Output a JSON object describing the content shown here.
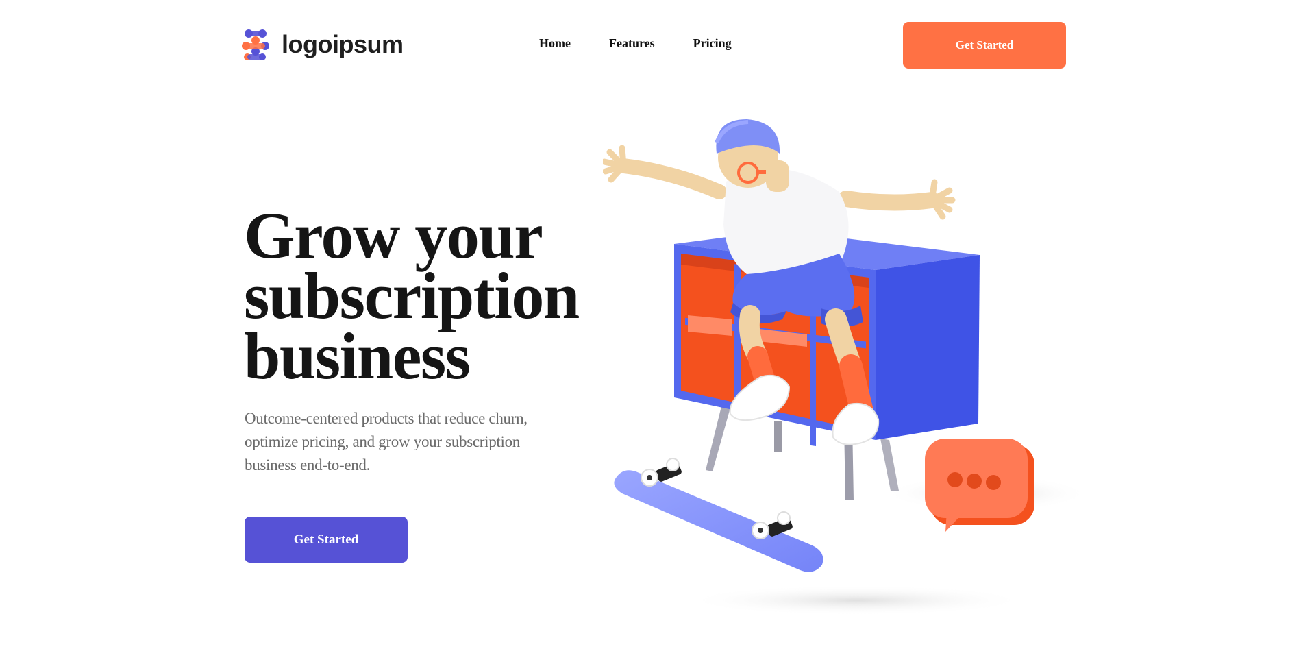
{
  "brand": {
    "name": "logoipsum",
    "logo_icon": "logo-mark-icon"
  },
  "nav": {
    "items": [
      {
        "label": "Home"
      },
      {
        "label": "Features"
      },
      {
        "label": "Pricing"
      }
    ]
  },
  "header": {
    "cta_label": "Get Started"
  },
  "hero": {
    "title": "Grow your subscription business",
    "subtitle": "Outcome-centered products that reduce churn, optimize pricing, and grow your subscription business end-to-end.",
    "cta_label": "Get Started"
  },
  "colors": {
    "accent_orange": "#ff7144",
    "accent_purple": "#5652d6",
    "illustration_blue": "#5468ee"
  }
}
